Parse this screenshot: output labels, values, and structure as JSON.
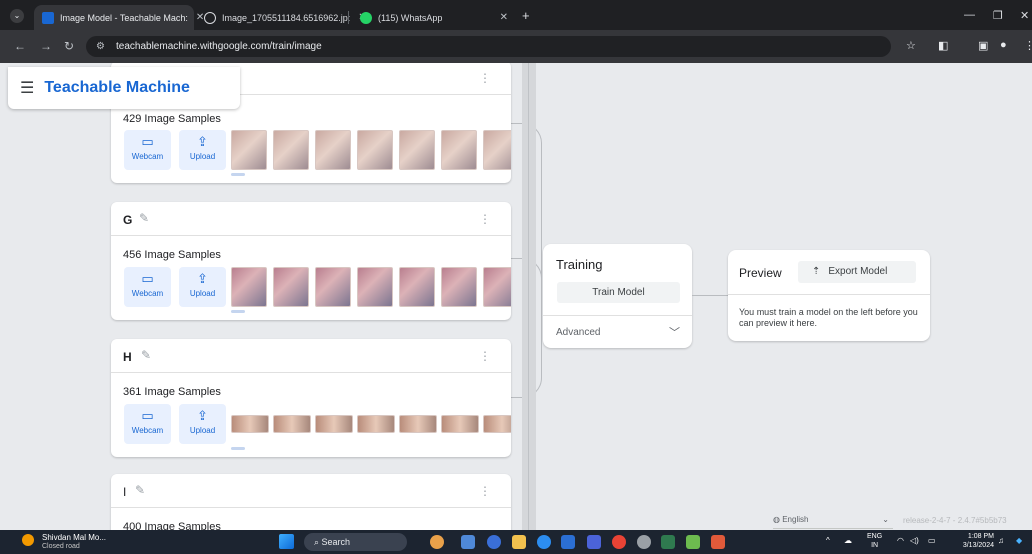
{
  "browser": {
    "tabs": [
      {
        "title": "Image Model - Teachable Mach:",
        "active": true
      },
      {
        "title": "Image_1705511184.6516962.jp:",
        "active": false
      },
      {
        "title": "(115) WhatsApp",
        "active": false
      }
    ],
    "url": "teachablemachine.withgoogle.com/train/image"
  },
  "app": {
    "logo": "Teachable Machine",
    "classes": [
      {
        "name": "",
        "samples": "429 Image Samples"
      },
      {
        "name": "G",
        "samples": "456 Image Samples"
      },
      {
        "name": "H",
        "samples": "361 Image Samples"
      },
      {
        "name": "I",
        "samples": "400 Image Samples"
      }
    ],
    "webcam_label": "Webcam",
    "upload_label": "Upload",
    "training": {
      "title": "Training",
      "button": "Train Model",
      "advanced": "Advanced"
    },
    "preview": {
      "title": "Preview",
      "export": "Export Model",
      "message": "You must train a model on the left before you can preview it here."
    },
    "language": "English",
    "release": "release-2-4-7 - 2.4.7#5b5b73"
  },
  "taskbar": {
    "weather_title": "Shivdan Mal Mo...",
    "weather_sub": "Closed road",
    "search": "Search",
    "lang_top": "ENG",
    "lang_bottom": "IN",
    "time": "1:08 PM",
    "date": "3/13/2024"
  },
  "colors": {
    "accent": "#1967d2",
    "button_bg": "#e8f0fe"
  }
}
